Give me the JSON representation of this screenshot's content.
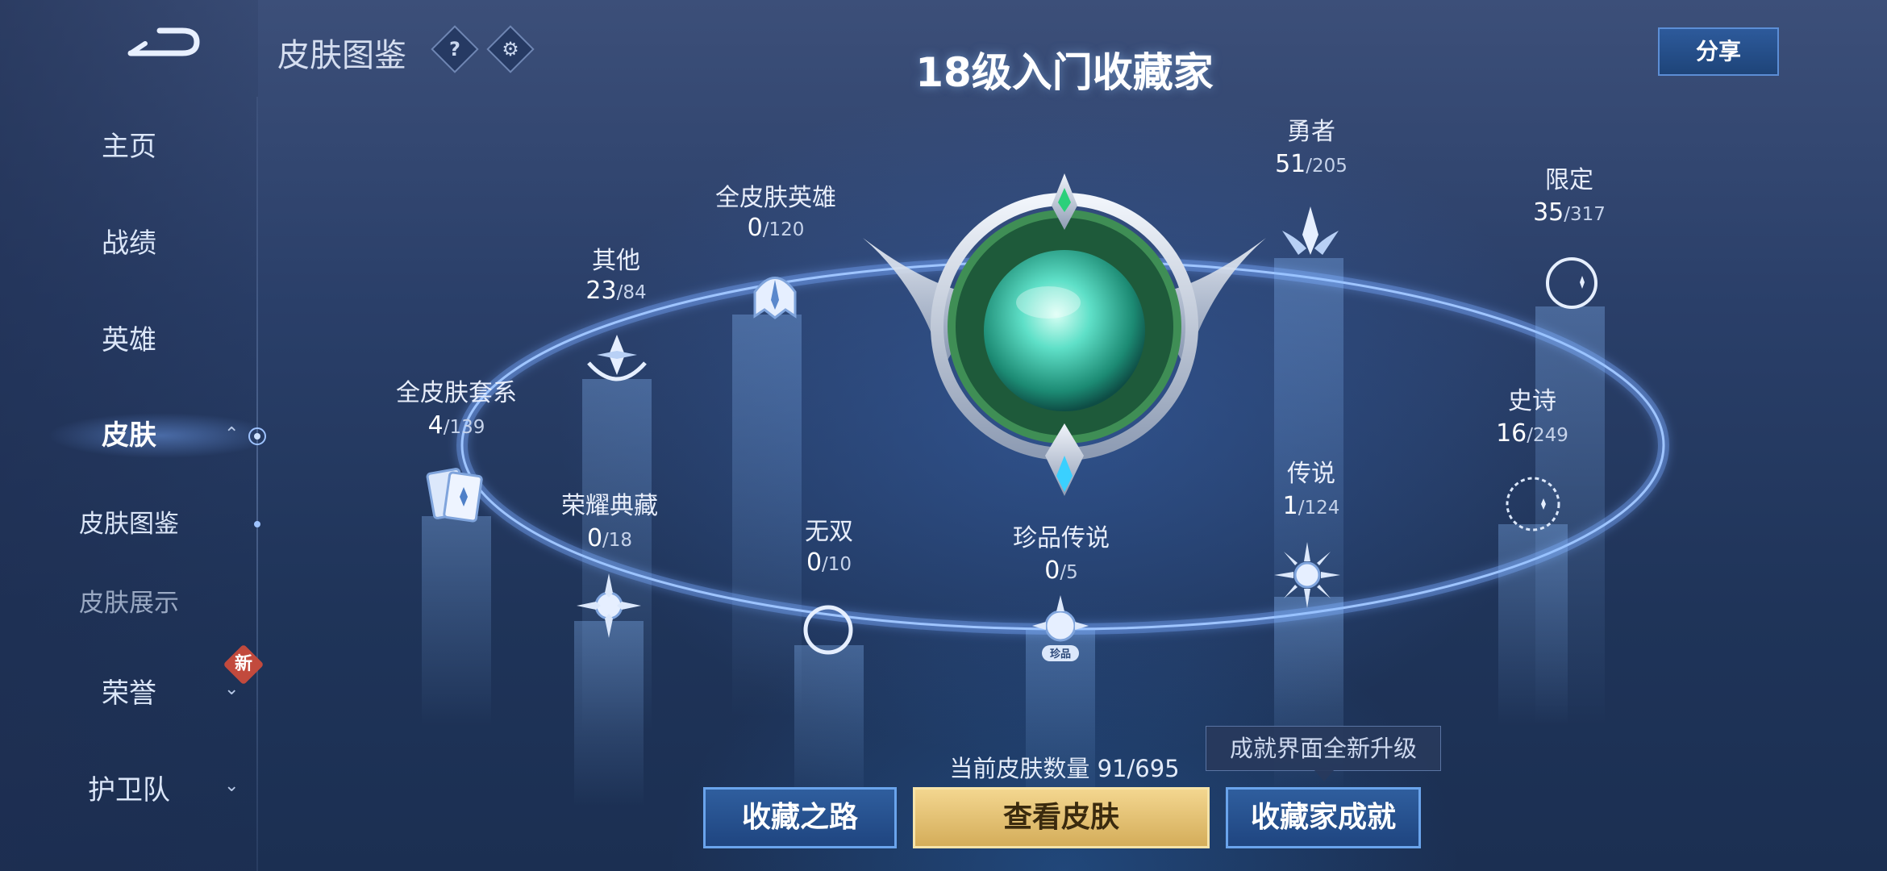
{
  "header": {
    "page_title": "皮肤图鉴",
    "help_symbol": "?",
    "share_label": "分享",
    "level_title": "18级入门收藏家"
  },
  "sidebar": {
    "items": [
      {
        "label": "主页"
      },
      {
        "label": "战绩"
      },
      {
        "label": "英雄"
      },
      {
        "label": "皮肤"
      },
      {
        "label": "皮肤图鉴"
      },
      {
        "label": "皮肤展示"
      },
      {
        "label": "荣誉",
        "badge": "新"
      },
      {
        "label": "护卫队"
      }
    ]
  },
  "categories": [
    {
      "name": "全皮肤套系",
      "count": "4",
      "total": "/139",
      "icon": "cards-icon"
    },
    {
      "name": "其他",
      "count": "23",
      "total": "/84",
      "icon": "lotus-star-icon"
    },
    {
      "name": "全皮肤英雄",
      "count": "0",
      "total": "/120",
      "icon": "helmet-icon"
    },
    {
      "name": "荣耀典藏",
      "count": "0",
      "total": "/18",
      "icon": "winged-sun-icon"
    },
    {
      "name": "无双",
      "count": "0",
      "total": "/10",
      "icon": "crescent-icon"
    },
    {
      "name": "珍品传说",
      "count": "0",
      "total": "/5",
      "icon": "treasure-sun-icon",
      "tag": "珍品"
    },
    {
      "name": "勇者",
      "count": "51",
      "total": "/205",
      "icon": "star-wing-icon"
    },
    {
      "name": "传说",
      "count": "1",
      "total": "/124",
      "icon": "sunburst-icon"
    },
    {
      "name": "限定",
      "count": "35",
      "total": "/317",
      "icon": "moon-star-icon"
    },
    {
      "name": "史诗",
      "count": "16",
      "total": "/249",
      "icon": "moon-ring-icon"
    }
  ],
  "footer": {
    "count_text": "当前皮肤数量 91/695",
    "tooltip": "成就界面全新升级",
    "buttons": {
      "road": "收藏之路",
      "view": "查看皮肤",
      "achievement": "收藏家成就"
    }
  },
  "colors": {
    "accent_blue": "#6aa4ec",
    "gold": "#d4ad5a",
    "badge_red": "#c24a3d",
    "orb_green": "#5fe0c8"
  }
}
